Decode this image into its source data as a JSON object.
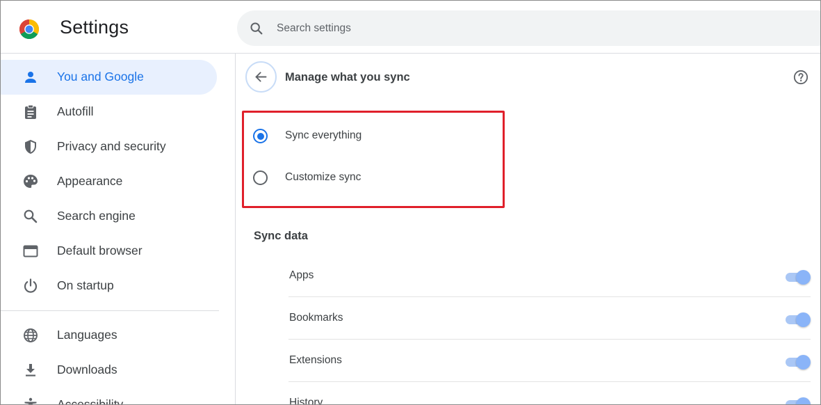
{
  "header": {
    "title": "Settings",
    "search_placeholder": "Search settings"
  },
  "sidebar": {
    "items": [
      {
        "label": "You and Google",
        "icon": "person-icon",
        "active": true
      },
      {
        "label": "Autofill",
        "icon": "clipboard-icon"
      },
      {
        "label": "Privacy and security",
        "icon": "shield-icon"
      },
      {
        "label": "Appearance",
        "icon": "palette-icon"
      },
      {
        "label": "Search engine",
        "icon": "search-icon"
      },
      {
        "label": "Default browser",
        "icon": "browser-window-icon"
      },
      {
        "label": "On startup",
        "icon": "power-icon"
      },
      {
        "label": "Languages",
        "icon": "globe-icon"
      },
      {
        "label": "Downloads",
        "icon": "download-icon"
      },
      {
        "label": "Accessibility",
        "icon": "accessibility-icon"
      }
    ]
  },
  "main": {
    "title": "Manage what you sync",
    "sync_options": [
      {
        "label": "Sync everything",
        "checked": true
      },
      {
        "label": "Customize sync",
        "checked": false
      }
    ],
    "sync_data_heading": "Sync data",
    "sync_items": [
      {
        "label": "Apps",
        "enabled": true
      },
      {
        "label": "Bookmarks",
        "enabled": true
      },
      {
        "label": "Extensions",
        "enabled": true
      },
      {
        "label": "History",
        "enabled": true
      }
    ]
  },
  "colors": {
    "accent": "#1a73e8",
    "active_nav_bg": "#e8f0fe",
    "highlight_border": "#e0202b",
    "toggle_on": "#8ab4f8"
  }
}
